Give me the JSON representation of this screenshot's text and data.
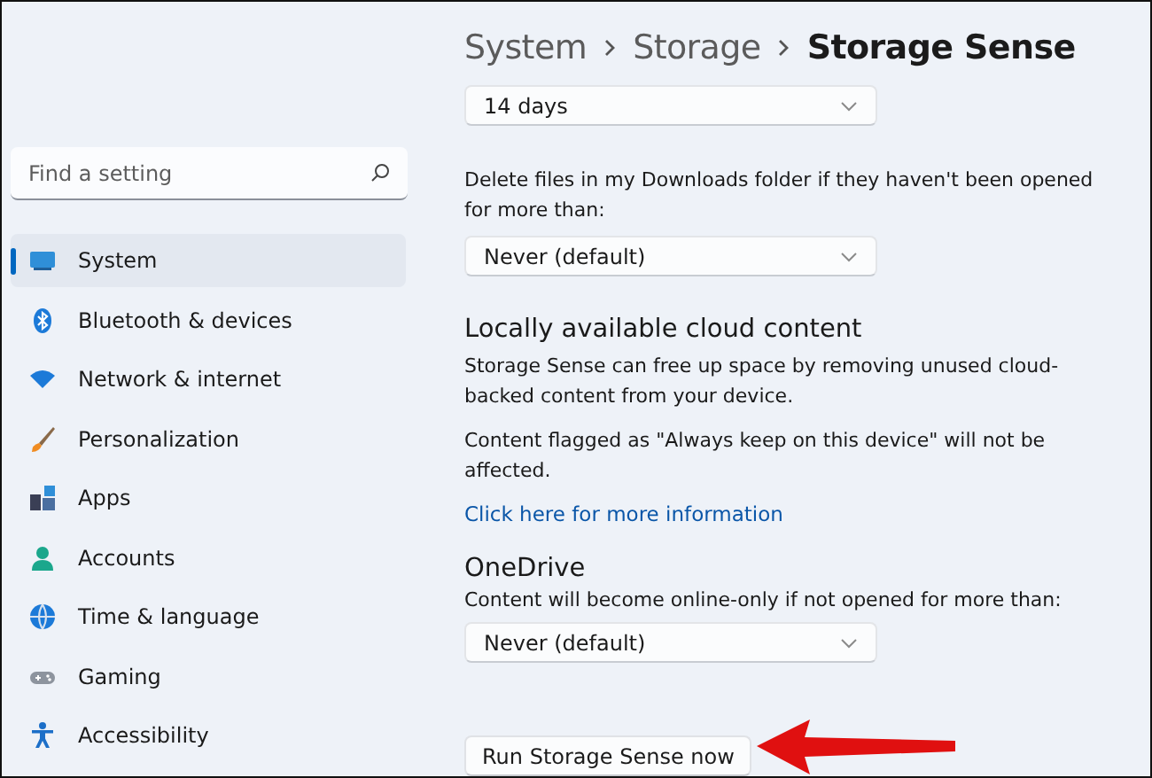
{
  "search": {
    "placeholder": "Find a setting"
  },
  "sidebar": {
    "items": [
      {
        "label": "System",
        "selected": true
      },
      {
        "label": "Bluetooth & devices",
        "selected": false
      },
      {
        "label": "Network & internet",
        "selected": false
      },
      {
        "label": "Personalization",
        "selected": false
      },
      {
        "label": "Apps",
        "selected": false
      },
      {
        "label": "Accounts",
        "selected": false
      },
      {
        "label": "Time & language",
        "selected": false
      },
      {
        "label": "Gaming",
        "selected": false
      },
      {
        "label": "Accessibility",
        "selected": false
      }
    ]
  },
  "breadcrumb": [
    "System",
    "Storage",
    "Storage Sense"
  ],
  "content": {
    "top_dropdown": {
      "value": "14 days"
    },
    "downloads": {
      "label": "Delete files in my Downloads folder if they haven't been opened for more than:",
      "dropdown": "Never (default)"
    },
    "cloud": {
      "title": "Locally available cloud content",
      "description": "Storage Sense can free up space by removing unused cloud-backed content from your device.",
      "note": "Content flagged as \"Always keep on this device\" will not be affected.",
      "link": "Click here for more information"
    },
    "onedrive": {
      "title": "OneDrive",
      "label": "Content will become online-only if not opened for more than:",
      "dropdown": "Never (default)"
    },
    "run_button": "Run Storage Sense now"
  }
}
